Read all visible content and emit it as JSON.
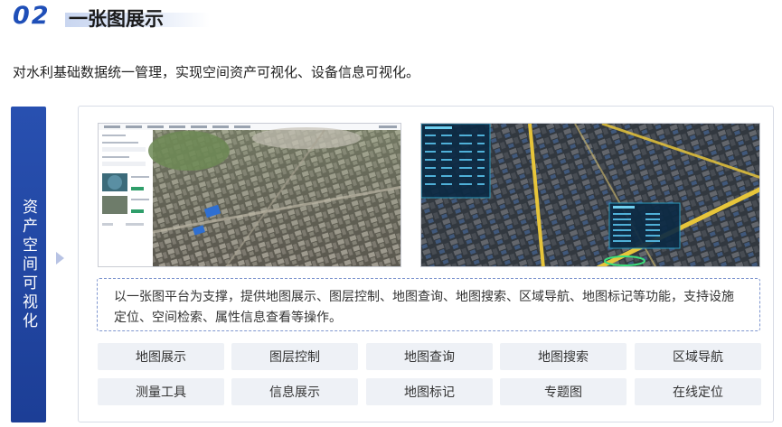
{
  "header": {
    "number": "02",
    "title": "一张图展示"
  },
  "subtitle": "对水利基础数据统一管理，实现空间资产可视化、设备信息可视化。",
  "sidebar": {
    "label": "资产空间可视化"
  },
  "description": "以一张图平台为支撑，提供地图展示、图层控制、地图查询、地图搜索、区域导航、地图标记等功能，支持设施定位、空间检索、属性信息查看等操作。",
  "features": [
    "地图展示",
    "图层控制",
    "地图查询",
    "地图搜索",
    "区域导航",
    "测量工具",
    "信息展示",
    "地图标记",
    "专题图",
    "在线定位"
  ],
  "colors": {
    "accent": "#1f4fb8",
    "sidebar": "#2850b0",
    "tag_bg": "#eef1f6",
    "dashed_border": "#7f96cf"
  }
}
